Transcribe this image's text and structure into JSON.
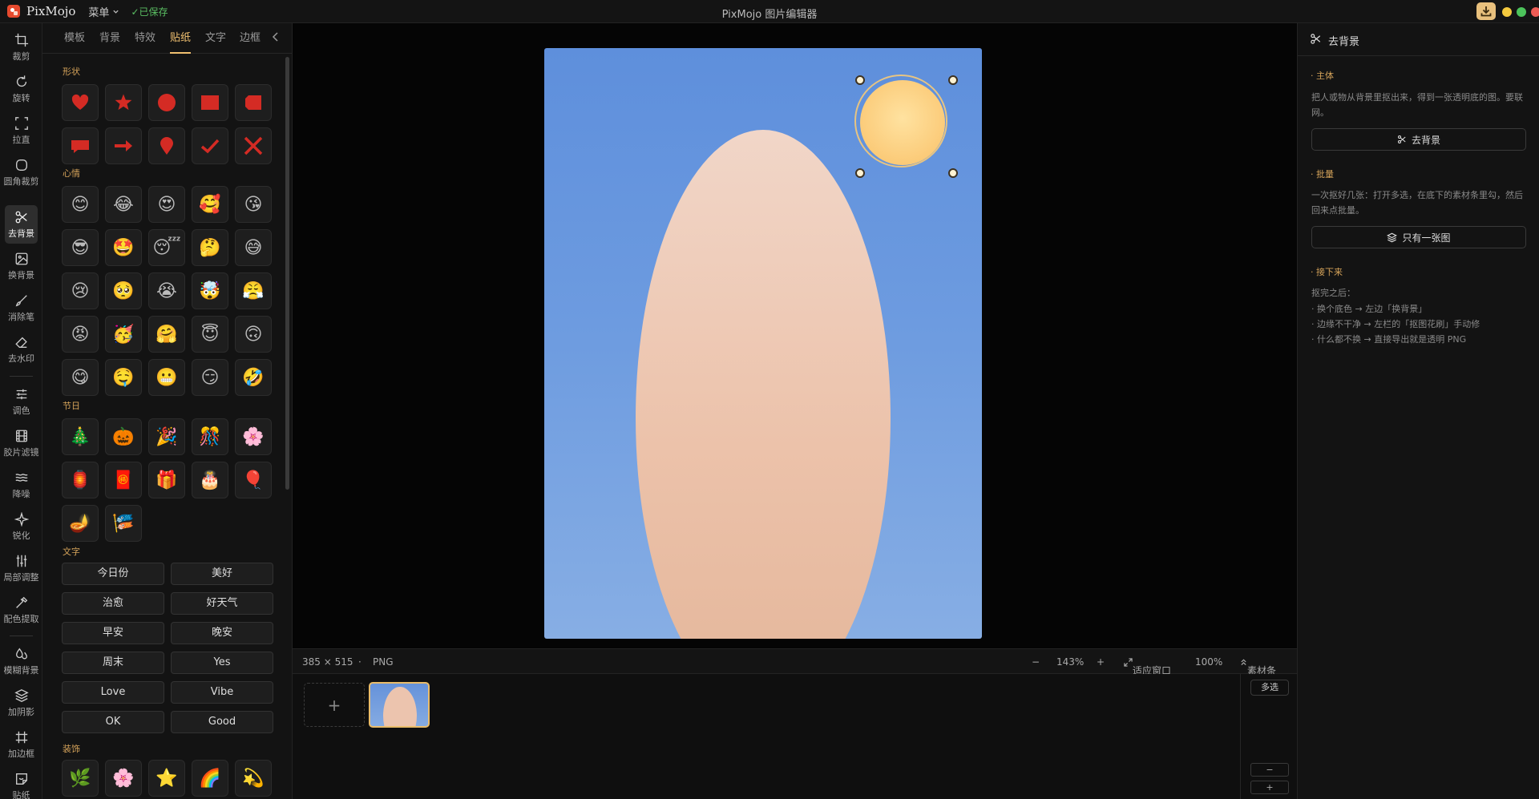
{
  "titlebar": {
    "app_name": "PixMojo",
    "menu_label": "菜单",
    "saved_status": "✓已保存",
    "window_title": "PixMojo 图片编辑器"
  },
  "tools": [
    {
      "label": "裁剪",
      "icon": "crop-icon"
    },
    {
      "label": "旋转",
      "icon": "rotate-icon"
    },
    {
      "label": "拉直",
      "icon": "straighten-icon"
    },
    {
      "label": "圆角裁剪",
      "icon": "rounded-crop-icon"
    },
    {
      "label": "去背景",
      "icon": "scissors-icon",
      "active": true
    },
    {
      "label": "换背景",
      "icon": "image-icon"
    },
    {
      "label": "消除笔",
      "icon": "brush-icon"
    },
    {
      "label": "去水印",
      "icon": "eraser-icon"
    },
    {
      "label": "调色",
      "icon": "sliders-icon"
    },
    {
      "label": "胶片滤镜",
      "icon": "film-icon"
    },
    {
      "label": "降噪",
      "icon": "waves-icon"
    },
    {
      "label": "锐化",
      "icon": "sparkle-icon"
    },
    {
      "label": "局部调整",
      "icon": "local-adjust-icon"
    },
    {
      "label": "配色提取",
      "icon": "eyedropper-icon"
    },
    {
      "label": "模糊背景",
      "icon": "droplets-icon"
    },
    {
      "label": "加阴影",
      "icon": "layers-icon"
    },
    {
      "label": "加边框",
      "icon": "frame-icon"
    },
    {
      "label": "贴纸",
      "icon": "sticker-icon"
    }
  ],
  "panel": {
    "tabs": [
      "模板",
      "背景",
      "特效",
      "贴纸",
      "文字",
      "边框"
    ],
    "active_tab": "贴纸",
    "sections": {
      "shapes": "形状",
      "moods": "心情",
      "holidays": "节日",
      "text": "文字",
      "decor": "装饰"
    },
    "shapes": [
      "heart",
      "star",
      "circle",
      "square",
      "tag",
      "speech-bubble",
      "arrow",
      "pin",
      "check",
      "cross"
    ],
    "shape_color": "#d42b24",
    "moods": [
      "😊",
      "😂",
      "😍",
      "🥰",
      "😘",
      "😎",
      "🤩",
      "😴",
      "🤔",
      "😅",
      "😢",
      "🥺",
      "😭",
      "🤯",
      "😤",
      "😡",
      "🥳",
      "🤗",
      "😇",
      "🙃",
      "😋",
      "🤤",
      "😬",
      "😏",
      "🤣"
    ],
    "holidays": [
      "🎄",
      "🎃",
      "🎉",
      "🎊",
      "🌸",
      "🏮",
      "🧧",
      "🎁",
      "🎂",
      "🎈",
      "🪔",
      "🎏"
    ],
    "text_stickers": [
      "今日份",
      "美好",
      "治愈",
      "好天气",
      "早安",
      "晚安",
      "周末",
      "Yes",
      "Love",
      "Vibe",
      "OK",
      "Good"
    ],
    "decor": [
      "🌿",
      "🌸",
      "⭐",
      "🌈",
      "💫"
    ]
  },
  "status": {
    "dimensions": "385 × 515",
    "separator": "·",
    "format": "PNG",
    "zoom_out": "−",
    "zoom_level": "143%",
    "zoom_in": "+",
    "fit_label": "适应窗口",
    "actual_size": "100%",
    "filmstrip_label": "素材条"
  },
  "filmstrip": {
    "add_label": "+",
    "multi_select": "多选",
    "minus": "−",
    "plus": "+"
  },
  "right_panel": {
    "title": "去背景",
    "subject": {
      "heading": "主体",
      "desc": "把人或物从背景里抠出来，得到一张透明底的图。要联网。",
      "button": "去背景"
    },
    "batch": {
      "heading": "批量",
      "desc": "一次抠好几张：打开多选，在底下的素材条里勾，然后回来点批量。",
      "button": "只有一张图"
    },
    "next": {
      "heading": "接下来",
      "intro": "抠完之后：",
      "items": [
        "换个底色 → 左边「换背景」",
        "边缘不干净 → 左栏的「抠图花刷」手动修",
        "什么都不换 → 直接导出就是透明 PNG"
      ]
    }
  },
  "colors": {
    "accent": "#e9bc6a",
    "sky": "#6a98de",
    "skin": "#ecc2aa",
    "sun": "#fbcb79"
  }
}
